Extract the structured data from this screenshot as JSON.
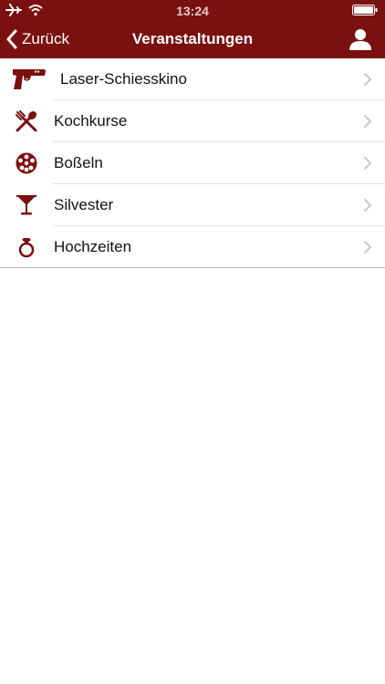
{
  "status_bar": {
    "time": "13:24"
  },
  "navbar": {
    "back_label": "Zurück",
    "title": "Veranstaltungen"
  },
  "items": [
    {
      "label": "Laser-Schiesskino",
      "icon": "pistol-icon"
    },
    {
      "label": "Kochkurse",
      "icon": "fork-knife-icon"
    },
    {
      "label": "Boßeln",
      "icon": "ball-icon"
    },
    {
      "label": "Silvester",
      "icon": "cocktail-glass-icon"
    },
    {
      "label": "Hochzeiten",
      "icon": "ring-icon"
    }
  ],
  "colors": {
    "brand": "#7a1010",
    "icon": "#7a1010",
    "chevron": "#c7c7cc"
  }
}
